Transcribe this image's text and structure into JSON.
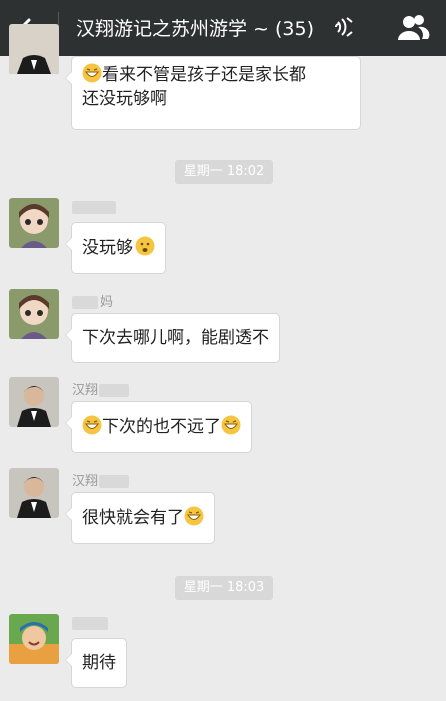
{
  "header": {
    "title": "汉翔游记之苏州游学 ~ (35)",
    "icons": [
      "back-arrow-icon",
      "voice-mode-icon",
      "group-members-icon"
    ]
  },
  "colors": {
    "header_bg": "#2e3132",
    "chat_bg": "#ebebeb",
    "timestamp_bg": "#d8d8d8",
    "emoji": "#f5c542"
  },
  "messages": {
    "m1": {
      "text_a": "看来不管是孩子还是家长都",
      "text_b": "还没玩够啊"
    },
    "t1": "星期一 18:02",
    "m2": {
      "name_suffix": "",
      "text": "没玩够"
    },
    "m3": {
      "name_suffix": "妈",
      "text": "下次去哪儿啊，能剧透不"
    },
    "m4": {
      "name_prefix": "汉翔",
      "text": "下次的也不远了"
    },
    "m5": {
      "name_prefix": "汉翔",
      "text": "很快就会有了"
    },
    "t2": "星期一 18:03",
    "m6": {
      "text": "期待"
    }
  }
}
